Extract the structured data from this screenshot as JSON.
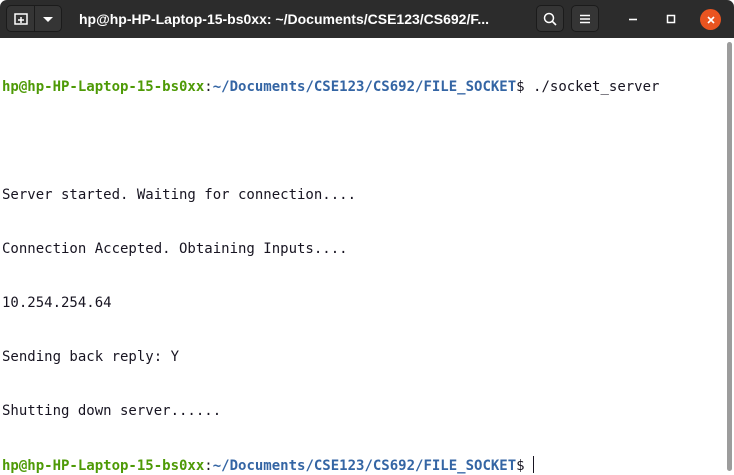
{
  "window": {
    "title": "hp@hp-HP-Laptop-15-bs0xx: ~/Documents/CSE123/CS692/F...",
    "close_color": "#e95420"
  },
  "titlebar": {
    "icons": {
      "new_tab": "new-tab-icon",
      "tab_menu": "chevron-down-icon",
      "search": "search-icon",
      "menu": "hamburger-menu-icon",
      "minimize": "minimize-icon",
      "maximize": "maximize-icon",
      "close": "close-icon"
    }
  },
  "terminal": {
    "prompt_user": "hp@hp-HP-Laptop-15-bs0xx",
    "prompt_sep": ":",
    "prompt_path": "~/Documents/CSE123/CS692/FILE_SOCKET",
    "prompt_symbol": "$ ",
    "command": "./socket_server",
    "output": [
      "",
      "Server started. Waiting for connection....",
      "Connection Accepted. Obtaining Inputs....",
      "10.254.254.64",
      "Sending back reply: Y",
      "Shutting down server......"
    ],
    "colors": {
      "user": "#4e9a06",
      "path": "#3465a4",
      "text": "#171421"
    }
  }
}
